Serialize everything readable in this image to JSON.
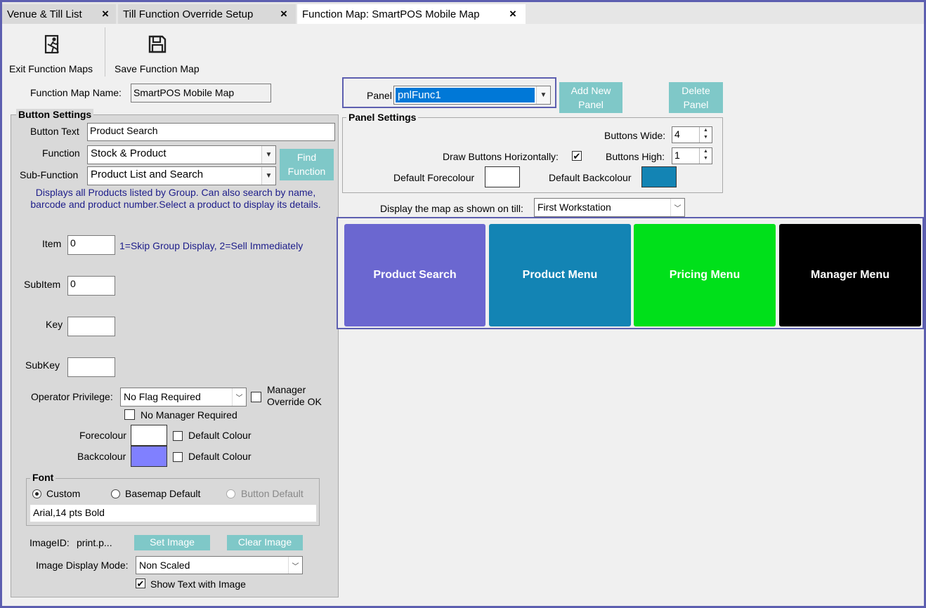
{
  "tabs": [
    {
      "label": "Venue & Till List"
    },
    {
      "label": "Till Function Override Setup"
    },
    {
      "label": "Function Map: SmartPOS Mobile Map"
    }
  ],
  "tab_close": "×",
  "toolbar": {
    "exit_label": "Exit Function Maps",
    "save_label": "Save Function Map"
  },
  "function_map_name": {
    "label": "Function Map Name:",
    "value": "SmartPOS Mobile Map"
  },
  "button_settings": {
    "title": "Button Settings",
    "button_text_label": "Button Text",
    "button_text_value": "Product Search",
    "function_label": "Function",
    "function_value": "Stock & Product",
    "sub_function_label": "Sub-Function",
    "sub_function_value": "Product List and Search",
    "find_function_label": "Find Function",
    "description": "Displays all Products listed by Group. Can also search by name, barcode and product number.Select a product to display its details.",
    "item_label": "Item",
    "item_value": "0",
    "item_hint": "1=Skip Group Display, 2=Sell Immediately",
    "subitem_label": "SubItem",
    "subitem_value": "0",
    "key_label": "Key",
    "key_value": "",
    "subkey_label": "SubKey",
    "subkey_value": "",
    "operator_privilege_label": "Operator Privilege:",
    "operator_privilege_value": "No Flag Required",
    "manager_override_label": "Manager Override OK",
    "manager_override_checked": false,
    "no_manager_label": "No Manager Required",
    "no_manager_checked": false,
    "forecolour_label": "Forecolour",
    "forecolour_color": "#ffffff",
    "forecolour_default_label": "Default Colour",
    "forecolour_default_checked": false,
    "backcolour_label": "Backcolour",
    "backcolour_color": "#8080ff",
    "backcolour_default_label": "Default Colour",
    "backcolour_default_checked": false
  },
  "font": {
    "title": "Font",
    "options": [
      {
        "label": "Custom",
        "selected": true,
        "enabled": true
      },
      {
        "label": "Basemap Default",
        "selected": false,
        "enabled": true
      },
      {
        "label": "Button Default",
        "selected": false,
        "enabled": false
      }
    ],
    "value": "Arial,14 pts Bold"
  },
  "image": {
    "id_label": "ImageID:",
    "id_value": "print.p...",
    "set_label": "Set Image",
    "clear_label": "Clear Image",
    "display_mode_label": "Image Display Mode:",
    "display_mode_value": "Non Scaled",
    "show_text_label": "Show Text with Image",
    "show_text_checked": true
  },
  "panel": {
    "label": "Panel",
    "value": "pnlFunc1",
    "add_label": "Add New Panel",
    "delete_label": "Delete Panel"
  },
  "panel_settings": {
    "title": "Panel Settings",
    "buttons_wide_label": "Buttons Wide:",
    "buttons_wide_value": "4",
    "buttons_high_label": "Buttons High:",
    "buttons_high_value": "1",
    "draw_horizontal_label": "Draw Buttons Horizontally:",
    "draw_horizontal_checked": true,
    "default_fore_label": "Default Forecolour",
    "default_fore_color": "#ffffff",
    "default_back_label": "Default Backcolour",
    "default_back_color": "#1384b4"
  },
  "display_map": {
    "label": "Display the map as shown on till:",
    "value": "First Workstation"
  },
  "preview_buttons": [
    {
      "label": "Product Search",
      "color": "#6b67d0"
    },
    {
      "label": "Product Menu",
      "color": "#1384b4"
    },
    {
      "label": "Pricing Menu",
      "color": "#00e01a"
    },
    {
      "label": "Manager Menu",
      "color": "#000000"
    }
  ],
  "icons": {
    "exit": "exit-door-icon",
    "save": "floppy-disk-icon",
    "dropdown": "chevron-down-icon"
  }
}
